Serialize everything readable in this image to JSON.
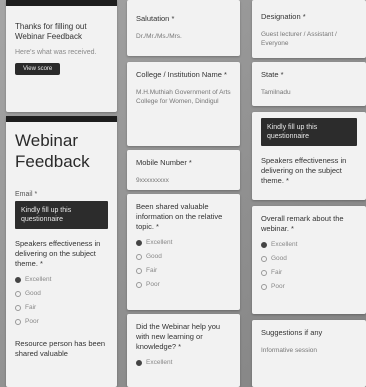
{
  "thanks_card": {
    "title": "Thanks for filling out Webinar Feedback",
    "subtitle": "Here's what was received.",
    "button_label": "View score"
  },
  "form": {
    "title": "Webinar Feedback",
    "email_label": "Email *",
    "section1_banner": "Kindly fill up this questionnaire"
  },
  "questions": {
    "q_speakers_col1": {
      "label": "Speakers effectiveness in delivering on the subject theme. *",
      "options": [
        "Excellent",
        "Good",
        "Fair",
        "Poor"
      ],
      "selected": "Excellent"
    },
    "q_resource_col1": {
      "label": "Resource person has been shared valuable"
    },
    "q_salutation": {
      "label": "Salutation *",
      "answer": "Dr./Mr./Ms./Mrs."
    },
    "q_college": {
      "label": "College / Institution Name *",
      "answer": "M.H.Muthiah Government of Arts College for Women, Dindigul"
    },
    "q_mobile": {
      "label": "Mobile Number *",
      "answer": "9xxxxxxxxx"
    },
    "q_shared": {
      "label": "Been shared valuable information on the relative topic. *",
      "options": [
        "Excellent",
        "Good",
        "Fair",
        "Poor"
      ],
      "selected": "Excellent"
    },
    "q_learning": {
      "label": "Did the Webinar help you with new learning or knowledge? *",
      "options": [
        "Excellent"
      ],
      "selected": "Excellent"
    },
    "q_designation": {
      "label": "Designation *",
      "answer": "Guest lecturer / Assistant / Everyone"
    },
    "q_state": {
      "label": "State *",
      "answer": "Tamilnadu"
    },
    "section2_banner": "Kindly fill up this questionnaire",
    "q_speakers_col3": {
      "label": "Speakers effectiveness in delivering on the subject theme. *"
    },
    "q_overall": {
      "label": "Overall remark about the webinar. *",
      "options": [
        "Excellent",
        "Good",
        "Fair",
        "Poor"
      ],
      "selected": "Excellent"
    },
    "q_suggestions": {
      "label": "Suggestions if any",
      "answer": "Informative session"
    }
  },
  "colors": {
    "card_bg": "#f2f2f2",
    "banner_bg": "#2c2c2c",
    "page_bg": "#9a9a9a"
  }
}
